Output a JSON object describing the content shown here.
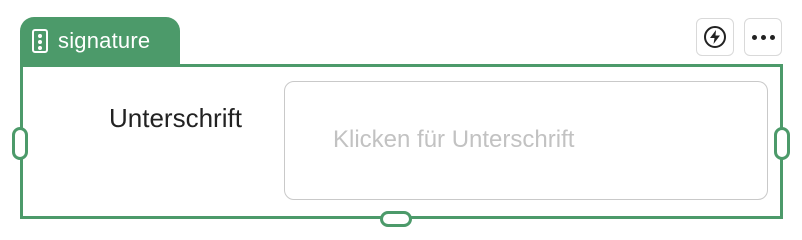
{
  "block": {
    "type_label": "signature",
    "type_icon": "form-field-icon",
    "accent_color": "#4c9a6a"
  },
  "actions": {
    "automation_icon": "bolt-circle-icon",
    "more_icon": "more-horizontal-icon"
  },
  "field": {
    "label": "Unterschrift",
    "placeholder": "Klicken für Unterschrift"
  }
}
